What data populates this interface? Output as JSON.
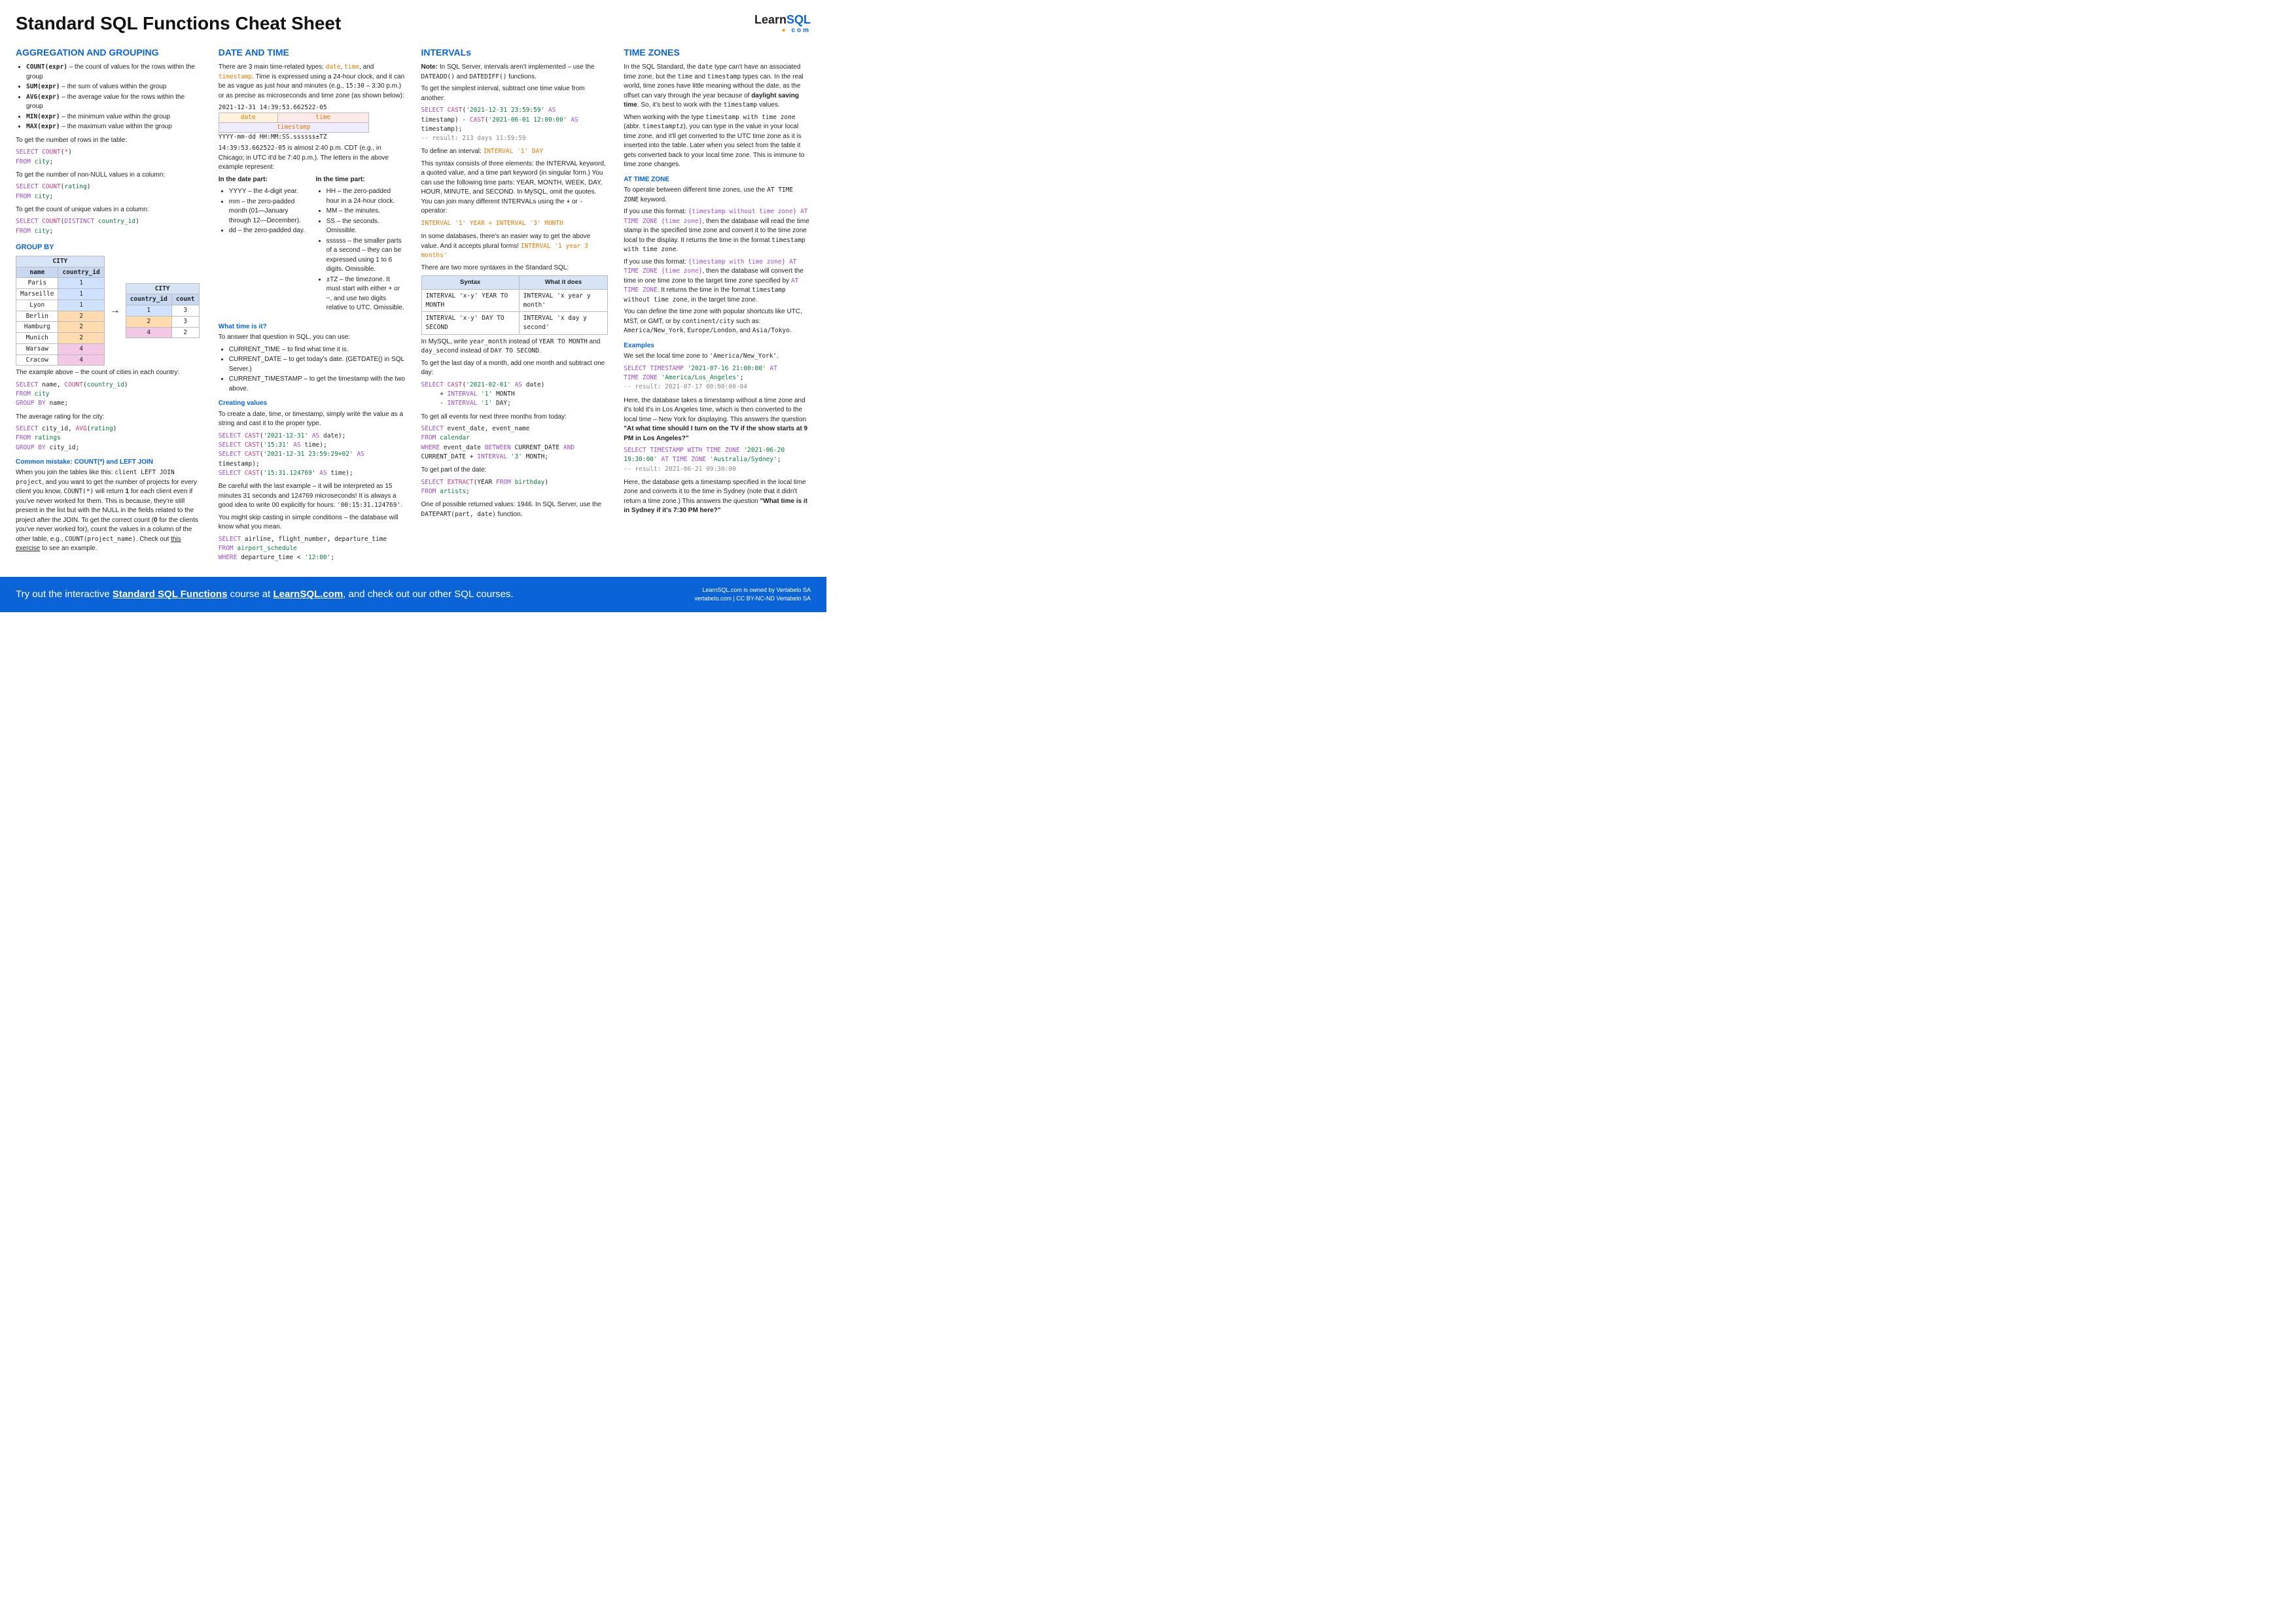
{
  "title": "Standard SQL Functions Cheat Sheet",
  "logo": {
    "learn": "Learn",
    "sql": "SQL",
    "com": "com"
  },
  "col1": {
    "h_agg": "AGGREGATION AND GROUPING",
    "fns": [
      {
        "sig": "COUNT(expr)",
        "desc": " – the count of values for the rows within the group"
      },
      {
        "sig": "SUM(expr)",
        "desc": " – the sum of values within the group"
      },
      {
        "sig": "AVG(expr)",
        "desc": " – the average value for the rows within the group"
      },
      {
        "sig": "MIN(expr)",
        "desc": " – the minimum value within the group"
      },
      {
        "sig": "MAX(expr)",
        "desc": " – the maximum value within the group"
      }
    ],
    "p_rows": "To get the number of rows in the table:",
    "p_nonnull": "To get the number of non-NULL values in a column:",
    "p_distinct": "To get the count of unique values in a column:",
    "h_groupby": "GROUP BY",
    "tbl1": {
      "title": "CITY",
      "h1": "name",
      "h2": "country_id",
      "rows": [
        [
          "Paris",
          "1",
          "c1"
        ],
        [
          "Marseille",
          "1",
          "c1"
        ],
        [
          "Lyon",
          "1",
          "c1"
        ],
        [
          "Berlin",
          "2",
          "c2"
        ],
        [
          "Hamburg",
          "2",
          "c2"
        ],
        [
          "Munich",
          "2",
          "c2"
        ],
        [
          "Warsaw",
          "4",
          "c4"
        ],
        [
          "Cracow",
          "4",
          "c4"
        ]
      ]
    },
    "tbl2": {
      "title": "CITY",
      "h1": "country_id",
      "h2": "count",
      "rows": [
        [
          "1",
          "3",
          "c1"
        ],
        [
          "2",
          "3",
          "c2"
        ],
        [
          "4",
          "2",
          "c4"
        ]
      ]
    },
    "p_ex": "The example above – the count of cities in each country:",
    "p_avgcity": "The average rating for the city:",
    "h_mistake": "Common mistake: COUNT(*) and LEFT JOIN",
    "p_mistake1": "When you join the tables like this: ",
    "c_join": "client LEFT JOIN project",
    "p_mistake2": ", and you want to get the number of projects for every client you know, ",
    "c_count": "COUNT(*)",
    "p_mistake3": " will return ",
    "b_one": "1",
    "p_mistake4": " for each client even if you've never worked for them. This is because, they're still present in the list but with the NULL in the fields related to the project after the JOIN. To get the correct count (",
    "b_zero": "0",
    "p_mistake5": " for the clients you've never worked for), count the values in a column of the other table, e.g., ",
    "c_countproj": "COUNT(project_name)",
    "p_mistake6": ". Check out ",
    "l_exercise": "this exercise",
    "p_mistake7": " to see an example."
  },
  "col2": {
    "h": "DATE AND TIME",
    "p_intro1": "There are 3 main time-related types: ",
    "t_date": "date",
    "t_time": "time",
    "t_ts": "timestamp",
    "p_intro2": ". Time is expressed using a 24-hour clock, and it can be as vague as just hour and minutes (e.g., ",
    "c_1530": "15:30",
    "p_intro3": " – 3:30 p.m.) or as precise as microseconds and time zone (as shown below):",
    "ts_line": "2021-12-31 14:39:53.662522-05",
    "lbl_date": "date",
    "lbl_time": "time",
    "lbl_ts": "timestamp",
    "ts_fmt": "YYYY-mm-dd HH:MM:SS.ssssss±TZ",
    "p_cdt1": "14:39:53.662522-05",
    "p_cdt2": " is almost 2:40 p.m. CDT (e.g., in Chicago; in UTC it'd be 7:40 p.m.). The letters in the above example represent:",
    "h_datepart": "In the date part:",
    "date_items": [
      "YYYY – the 4-digit year.",
      "mm – the zero-padded month (01—January through 12—December).",
      "dd – the zero-padded day."
    ],
    "h_timepart": "In the time part:",
    "time_items": [
      "HH – the zero-padded hour in a 24-hour clock.",
      "MM – the minutes.",
      "SS – the seconds. Omissible.",
      "ssssss – the smaller parts of a second – they can be expressed using 1 to 6 digits. Omissible.",
      "±TZ – the timezone. It must start with either + or −, and use two digits relative to UTC. Omissible."
    ],
    "h_what": "What time is it?",
    "p_what": "To answer that question in SQL, you can use:",
    "what_items": [
      "CURRENT_TIME – to find what time it is.",
      "CURRENT_DATE – to get today's date. (GETDATE() in SQL Server.)",
      "CURRENT_TIMESTAMP – to get the timestamp with the two above."
    ],
    "h_create": "Creating values",
    "p_create": "To create a date, time, or timestamp, simply write the value as a string and cast it to the proper type.",
    "p_careful1": "Be careful with the last example – it will be interpreted as 15 minutes 31 seconds and 124769 microseconds! It is always a good idea to write 00 explicitly for hours: ",
    "c_careful": "'00:15:31.124769'",
    "p_careful2": ".",
    "p_skip": "You might skip casting in simple conditions – the database will know what you mean."
  },
  "col3": {
    "h": "INTERVALs",
    "p_note1": "Note:",
    "p_note2": " In SQL Server, intervals aren't implemented – use the ",
    "c_dateadd": "DATEADD()",
    "p_note3": " and ",
    "c_datediff": "DATEDIFF()",
    "p_note4": " functions.",
    "p_simplest": "To get the simplest interval, subtract one time value from another:",
    "p_define": "To define an interval: ",
    "c_intday": "INTERVAL '1' DAY",
    "p_three1": "This syntax consists of three elements: the INTERVAL keyword, a quoted value, and a time part keyword (in singular form.) You can use the following time parts: YEAR, MONTH, WEEK, DAY, HOUR, MINUTE, and SECOND. In MySQL, omit the quotes. You can join many different INTERVALs using the ",
    "c_plus": "+",
    "p_three2": " or ",
    "c_minus": "-",
    "p_three3": " operator:",
    "c_intjoin": "INTERVAL '1' YEAR + INTERVAL '3' MONTH",
    "p_easier": "In some databases, there's an easier way to get the above value. And it accepts plural forms! ",
    "c_plural": "INTERVAL '1 year 3 months'",
    "p_twomore": "There are two more syntaxes in the Standard SQL:",
    "syn_h1": "Syntax",
    "syn_h2": "What it does",
    "syn_rows": [
      [
        "INTERVAL 'x-y' YEAR TO MONTH",
        "INTERVAL 'x year y month'"
      ],
      [
        "INTERVAL 'x-y' DAY TO SECOND",
        "INTERVAL 'x day y second'"
      ]
    ],
    "p_mysql1": "In MySQL, write ",
    "c_ym": "year_month",
    "p_mysql2": " instead of ",
    "c_ytm": "YEAR TO MONTH",
    "p_mysql3": " and ",
    "c_ds": "day_second",
    "p_mysql4": " instead of ",
    "c_dts": "DAY TO SECOND",
    "p_mysql5": ".",
    "p_lastday": "To get the last day of a month, add one month and subtract one day:",
    "p_events": "To get all events for next three months from today:",
    "p_part": "To get part of the date:",
    "p_ret1": "One of possible returned values: 1946. In SQL Server, use the ",
    "c_datepart": "DATEPART(part, date)",
    "p_ret2": " function."
  },
  "col4": {
    "h": "TIME ZONES",
    "p_tz1": "In the SQL Standard, the ",
    "c_date": "date",
    "p_tz2": " type can't have an associated time zone, but the ",
    "c_time": "time",
    "p_tz3": " and ",
    "c_ts": "timestamp",
    "p_tz4": " types can. In the real world, time zones have little meaning without the date, as the offset can vary through the year because of ",
    "b_dst": "daylight saving time",
    "p_tz5": ". So, it's best to work with the ",
    "c_tsvals": "timestamp",
    "p_tz6": " values.",
    "p_twtz1": "When working with the type ",
    "c_twtz": "timestamp with time zone",
    "p_twtz2": " (abbr. ",
    "c_tstz": "timestamptz",
    "p_twtz3": "), you can type in the value in your local time zone, and it'll get converted to the UTC time zone as it is inserted into the table. Later when you select from the table it gets converted back to your local time zone. This is immune to time zone changes.",
    "h_attz": "AT TIME ZONE",
    "p_attz1": "To operate between different time zones, use the ",
    "c_attz": "AT TIME ZONE",
    "p_attz2": " keyword.",
    "p_f1a": "If you use this format: ",
    "c_f1": "{timestamp without time zone} AT TIME ZONE {time zone}",
    "p_f1b": ", then the database will read the time stamp in the specified time zone and convert it to the time zone local to the display. It returns the time in the format ",
    "c_twtz2": "timestamp with time zone",
    "p_f1c": ".",
    "p_f2a": "If you use this format: ",
    "c_f2": "{timestamp with time zone} AT TIME ZONE {time zone}",
    "p_f2b": ", then the database will convert the time in one time zone to the target time zone specified by ",
    "c_attz2": "AT TIME ZONE",
    "p_f2c": ". It returns the time in the format ",
    "c_twotz": "timestamp without time zone",
    "p_f2d": ", in the target time zone.",
    "p_shortcut1": "You can define the time zone with popular shortcuts like UTC, MST, or GMT, or by ",
    "c_contcity": "continent/city",
    "p_shortcut2": " such as: ",
    "c_ny": "America/New_York",
    "c_lon": "Europe/London",
    "c_tok": "Asia/Tokyo",
    "h_ex": "Examples",
    "p_setlocal1": "We set the local time zone to ",
    "c_setny": "'America/New_York'",
    "p_setlocal2": ".",
    "p_q1a": "Here, the database takes a timestamp without a time zone and it's told it's in Los Angeles time, which is then converted to the local time – New York for displaying. This answers the question ",
    "b_q1": "\"At what time should I turn on the TV if the show starts at 9 PM in Los Angeles?\"",
    "p_q2a": "Here, the database gets a timestamp specified in the local time zone and converts it to the time in Sydney (note that it didn't return a time zone.) This answers the question ",
    "b_q2": "\"What time is it in Sydney if it's 7:30 PM here?\""
  },
  "footer": {
    "left1": "Try out the interactive ",
    "link1": "Standard SQL Functions",
    "left2": " course at ",
    "link2": "LearnSQL.com",
    "left3": ", and check out our other SQL courses.",
    "r1": "LearnSQL.com is owned by Vertabelo SA",
    "r2": "vertabelo.com | CC BY-NC-ND Vertabelo SA"
  }
}
